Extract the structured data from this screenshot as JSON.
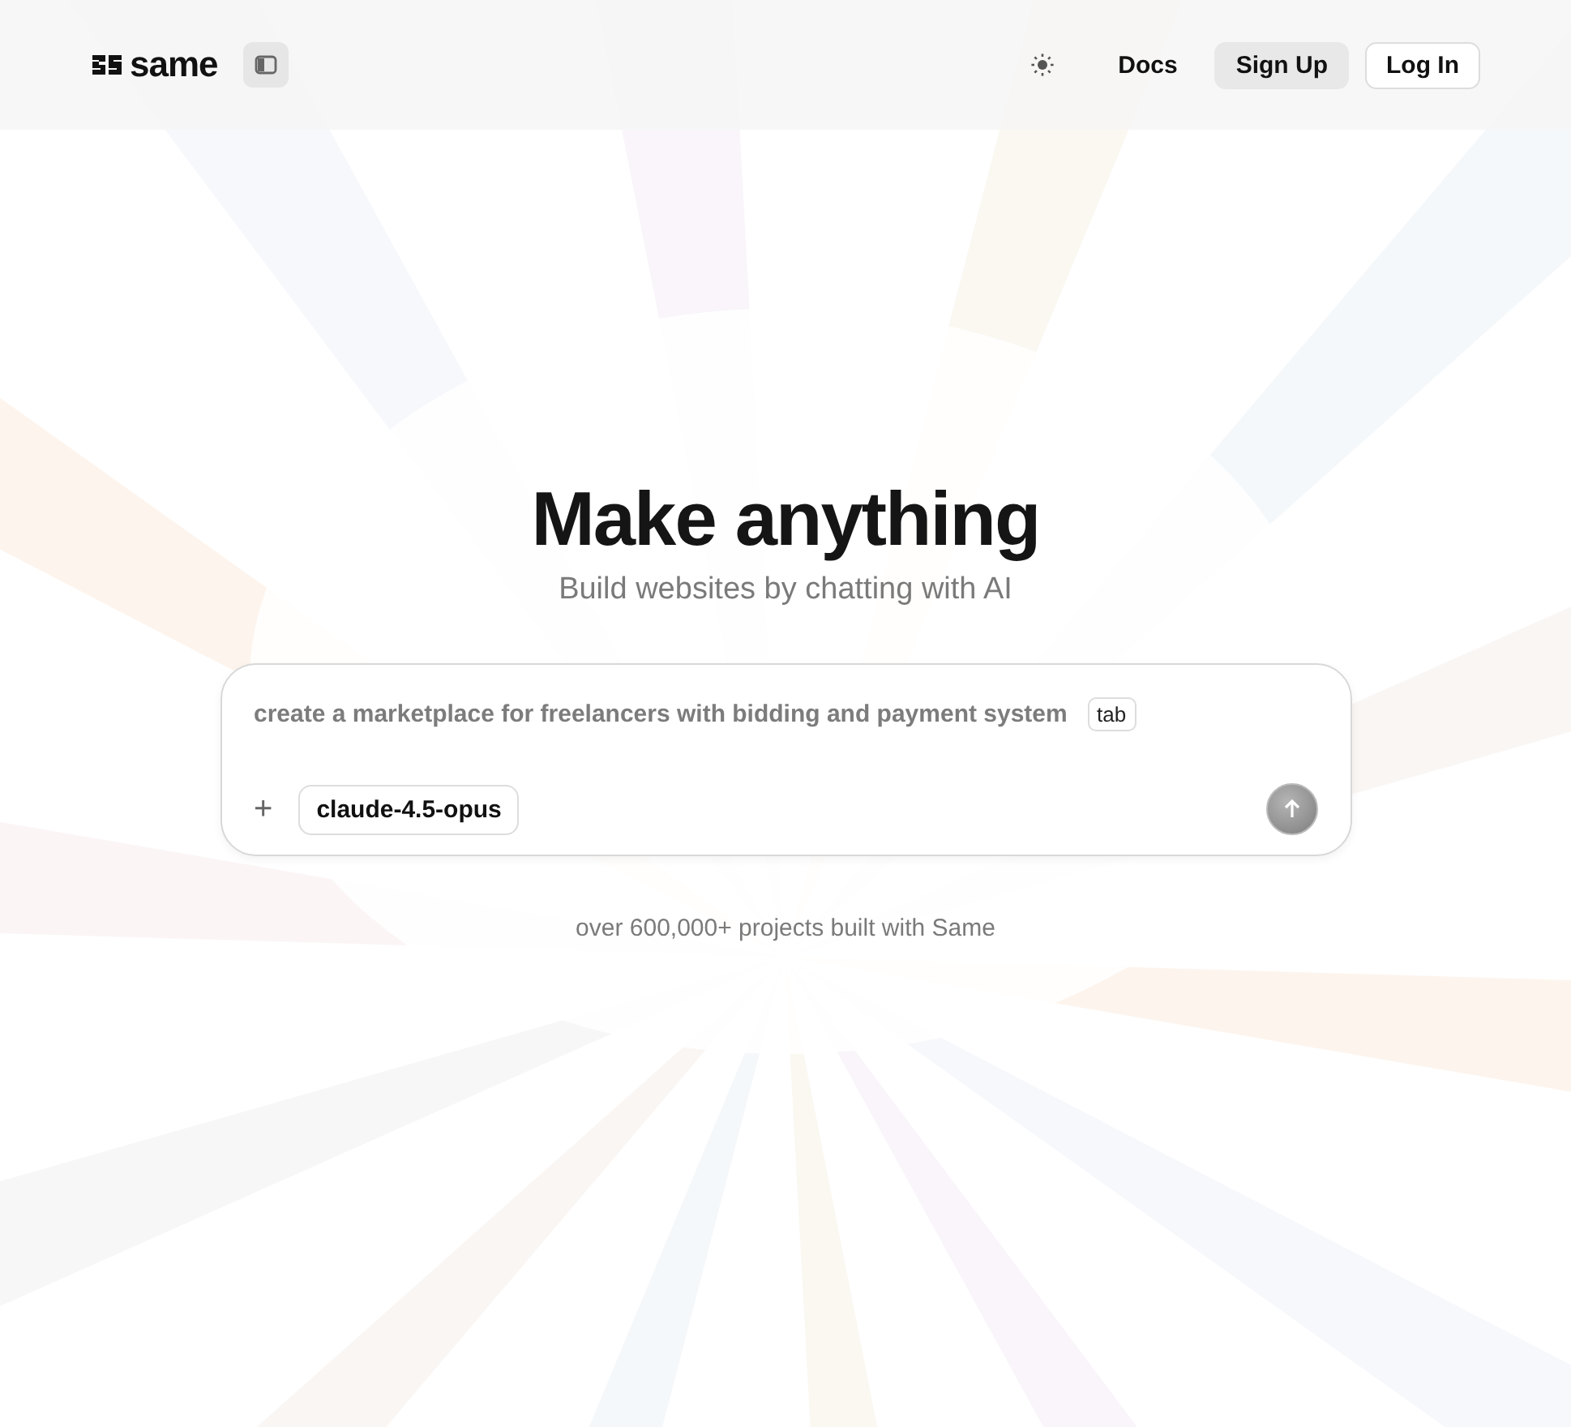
{
  "header": {
    "logo": "same",
    "nav": [
      {
        "label": "Docs",
        "kind": "plain"
      },
      {
        "label": "Sign Up",
        "kind": "filled"
      },
      {
        "label": "Log In",
        "kind": "outlined"
      }
    ]
  },
  "hero": {
    "title": "Make anything",
    "subtitle": "Build websites by chatting with AI"
  },
  "prompt": {
    "placeholder": "create a marketplace for freelancers with bidding and payment system",
    "key_hint": "tab",
    "add": "+",
    "model": "claude-4.5-opus"
  },
  "footer_note": "over 600,000+ projects built with Same"
}
